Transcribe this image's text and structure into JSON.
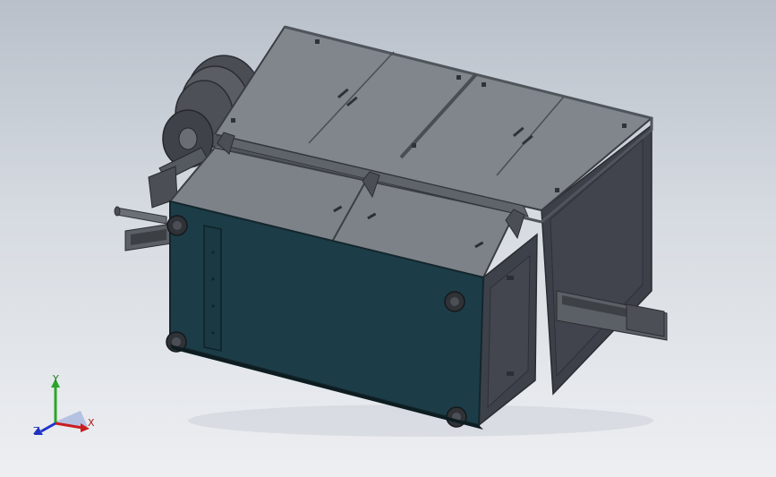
{
  "viewport": {
    "name": "3d-model-viewport",
    "background_top": "#b9c0ca",
    "background_bottom": "#edeff2"
  },
  "model": {
    "panel_color": "#1c3d47",
    "frame_color": "#5d6269",
    "cover_color": "#7e838a",
    "dark_side_color": "#3f424a"
  },
  "triad": {
    "x_label": "X",
    "y_label": "Y",
    "z_label": "Z",
    "x_color": "#c81e1e",
    "y_color": "#2aa52a",
    "z_color": "#2233c8"
  }
}
